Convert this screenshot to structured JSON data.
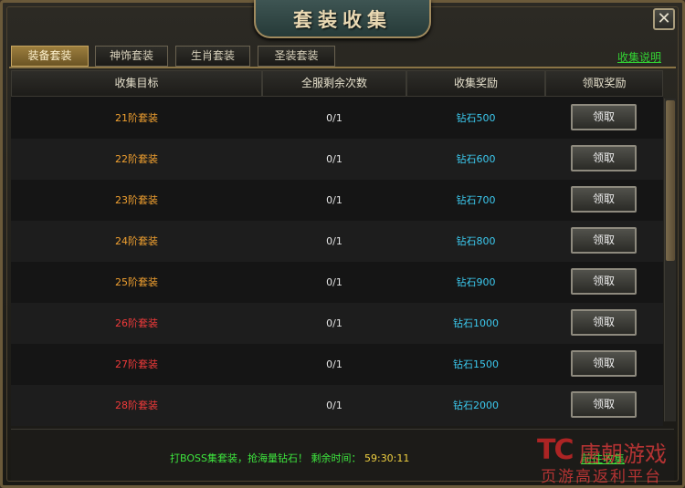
{
  "window": {
    "title": "套装收集",
    "close_label": "✕"
  },
  "tabs": [
    {
      "label": "装备套装",
      "active": true
    },
    {
      "label": "神饰套装",
      "active": false
    },
    {
      "label": "生肖套装",
      "active": false
    },
    {
      "label": "圣装套装",
      "active": false
    }
  ],
  "help_link": "收集说明",
  "columns": [
    "收集目标",
    "全服剩余次数",
    "收集奖励",
    "领取奖励"
  ],
  "rows": [
    {
      "goal": "21阶套装",
      "remaining": "0/1",
      "reward": "钻石500",
      "button": "领取",
      "goal_color": "orange"
    },
    {
      "goal": "22阶套装",
      "remaining": "0/1",
      "reward": "钻石600",
      "button": "领取",
      "goal_color": "orange"
    },
    {
      "goal": "23阶套装",
      "remaining": "0/1",
      "reward": "钻石700",
      "button": "领取",
      "goal_color": "orange"
    },
    {
      "goal": "24阶套装",
      "remaining": "0/1",
      "reward": "钻石800",
      "button": "领取",
      "goal_color": "orange"
    },
    {
      "goal": "25阶套装",
      "remaining": "0/1",
      "reward": "钻石900",
      "button": "领取",
      "goal_color": "orange"
    },
    {
      "goal": "26阶套装",
      "remaining": "0/1",
      "reward": "钻石1000",
      "button": "领取",
      "goal_color": "red"
    },
    {
      "goal": "27阶套装",
      "remaining": "0/1",
      "reward": "钻石1500",
      "button": "领取",
      "goal_color": "red"
    },
    {
      "goal": "28阶套装",
      "remaining": "0/1",
      "reward": "钻石2000",
      "button": "领取",
      "goal_color": "red"
    }
  ],
  "footer": {
    "message": "打BOSS集套装，抢海量钻石！",
    "time_label": "剩余时间：",
    "time_value": "59:30:11",
    "goto_link": "前往收集"
  },
  "watermark": {
    "logo": "TC",
    "title": "唐朝游戏",
    "subtitle": "页游高返利平台"
  },
  "colors": {
    "goal_orange": "#f0a030",
    "goal_red": "#f03a3a",
    "reward": "#3ccaf0",
    "link_green": "#33d233",
    "tab_active": "#9c7e3e"
  }
}
